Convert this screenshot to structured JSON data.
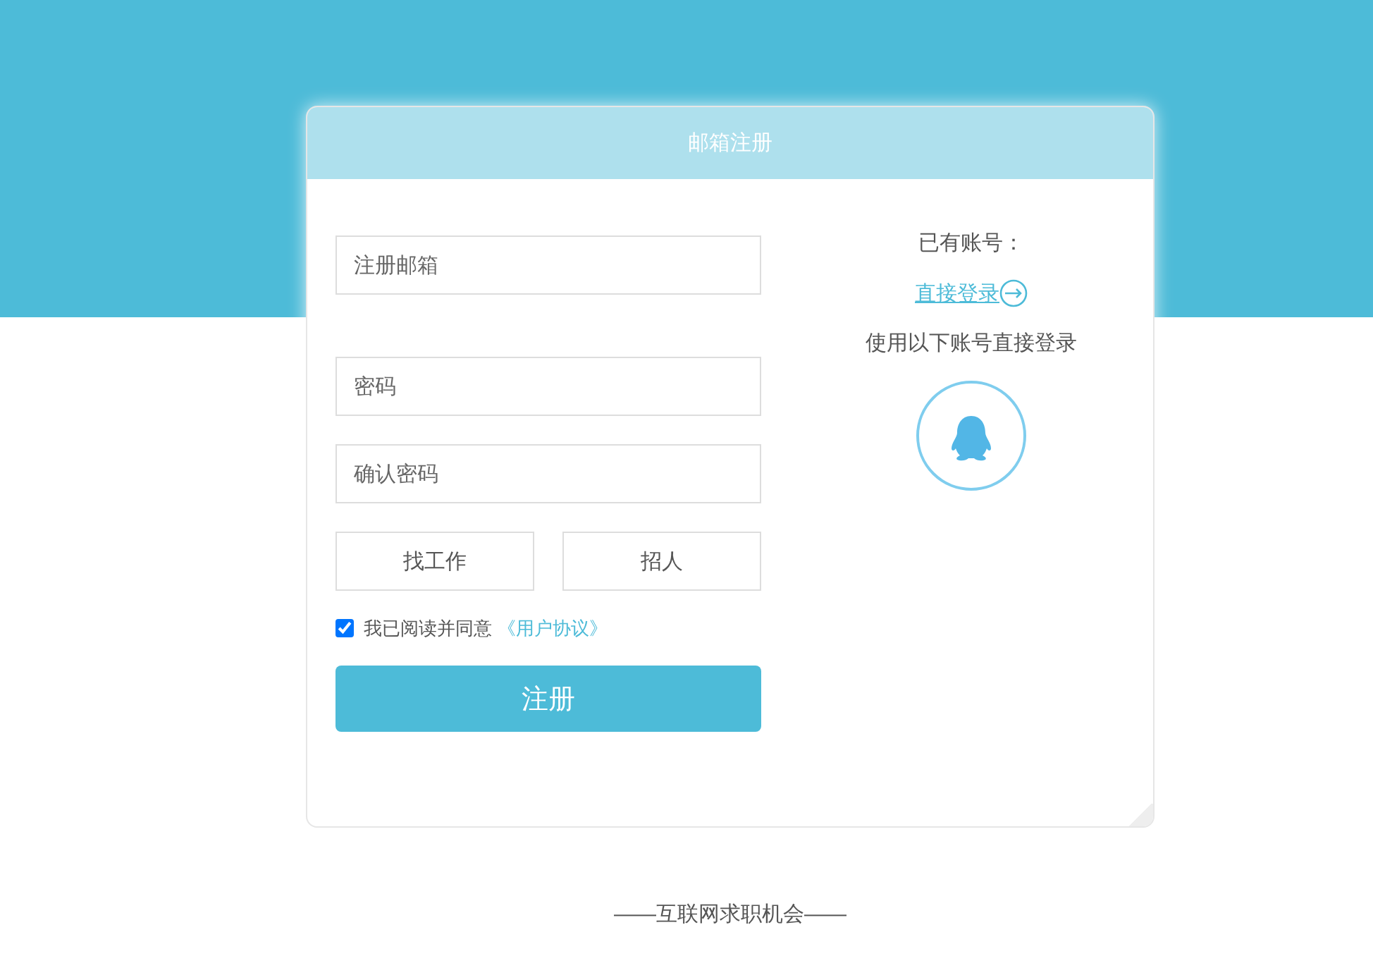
{
  "header": {
    "title": "邮箱注册"
  },
  "fields": [
    {
      "placeholder": "注册邮箱"
    },
    {
      "placeholder": "密码"
    },
    {
      "placeholder": "确认密码"
    }
  ],
  "roles": [
    {
      "label": "找工作",
      "selected": false
    },
    {
      "label": "招人",
      "selected": false
    }
  ],
  "agreement": {
    "checked": true,
    "text": "我已阅读并同意",
    "link": "《用户协议》"
  },
  "submit": "注册",
  "side": {
    "prompt": "已有账号：",
    "login_link": "直接登录",
    "social_prompt": "使用以下账号直接登录"
  },
  "footer": "——互联网求职机会——"
}
